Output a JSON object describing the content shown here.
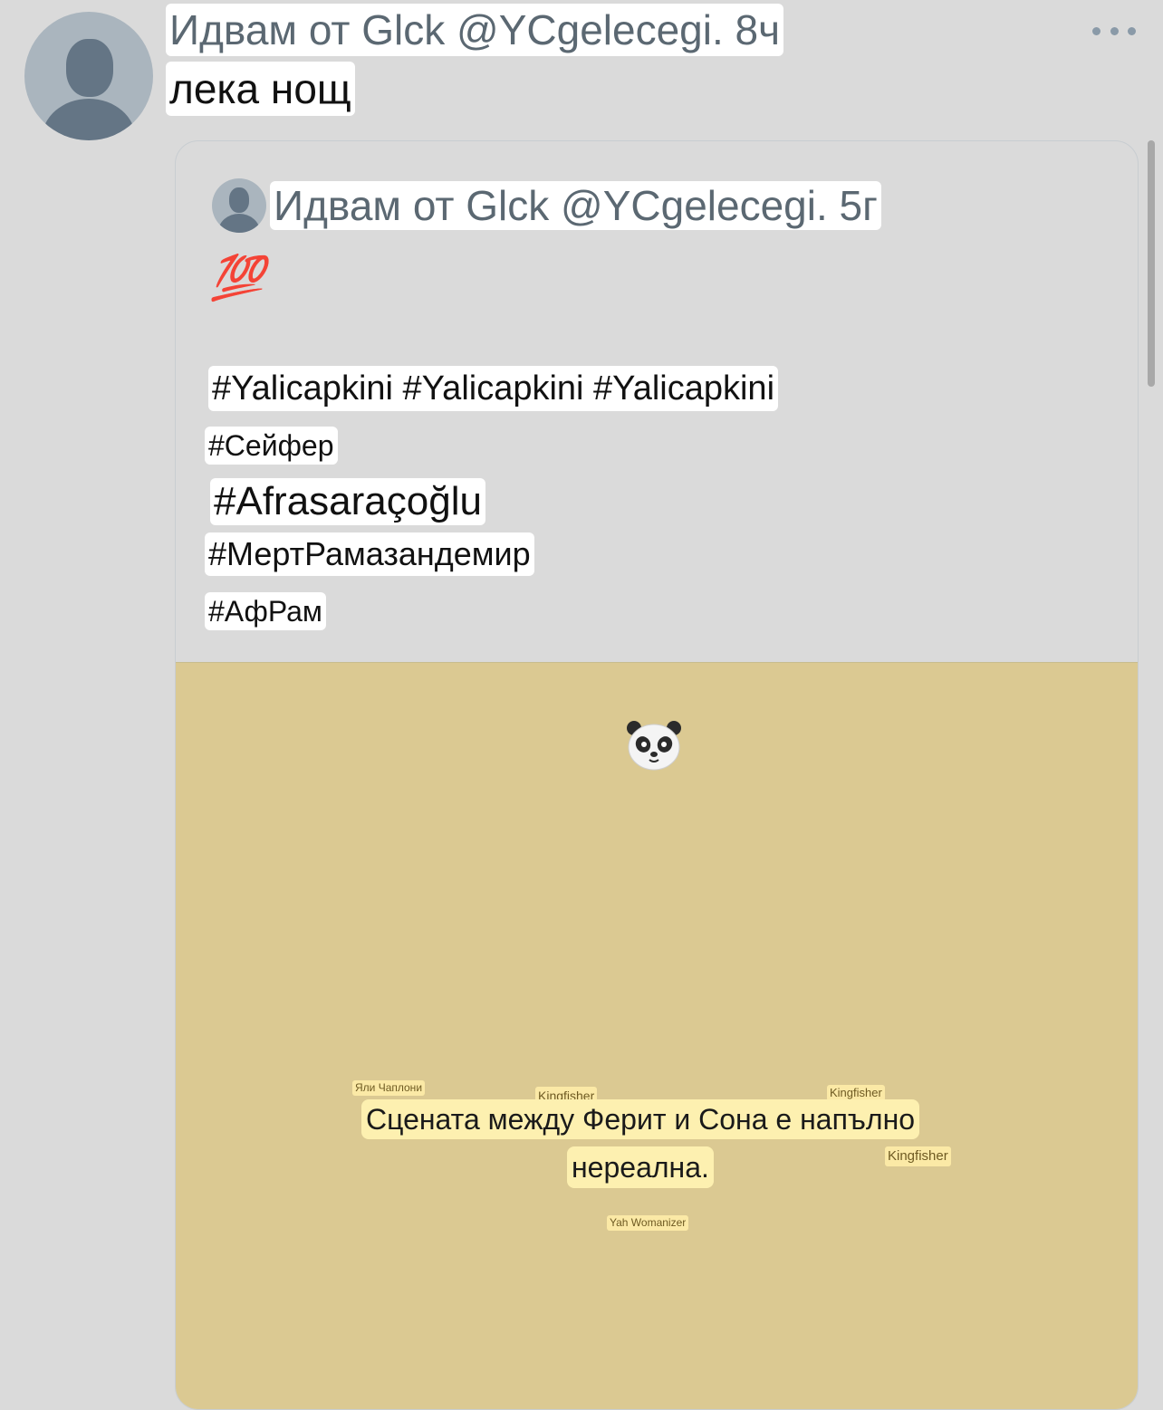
{
  "tweet": {
    "header": "Идвам от Glck @YCgelecegi. 8ч",
    "text": "лека нощ",
    "avatar_icon": "default-user-avatar",
    "more_icon": "more-horizontal-icon"
  },
  "quoted": {
    "header": "Идвам от Glck @YCgelecegi. 5г",
    "emoji": "💯",
    "hashtags": [
      "#Yalicapkini #Yalicapkini #Yalicapkini",
      "#Сейфер",
      "#Afrasaraçoğlu",
      "#МертРамазандемир",
      "#АфРам"
    ],
    "media": {
      "icon": "panda-icon",
      "labels": [
        "Яли Чаплони",
        "Kingfisher",
        "Kingfisher",
        "Kingfisher",
        "Yah Womanizer"
      ],
      "caption_lines": [
        "Сцената между Ферит и Сона е напълно",
        "нереална."
      ],
      "background_color": "#dbc992"
    }
  }
}
